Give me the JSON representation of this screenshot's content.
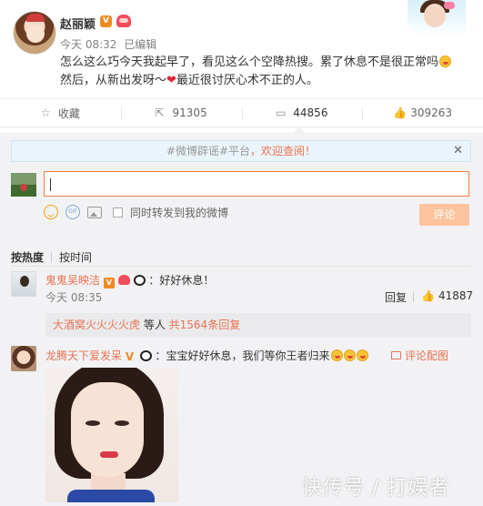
{
  "post": {
    "author": "赵丽颖",
    "verified_badge": "V",
    "time": "今天 08:32",
    "edited": "已编辑",
    "line1": "怎么这么巧今天我起早了，看见这么个空降热搜。累了休息不是很正常吗",
    "line2_a": "然后，从新出发呀～",
    "line2_b": "最近很讨厌心术不正的人。",
    "heart": "❤"
  },
  "actions": {
    "favorite": "收藏",
    "repost_count": "91305",
    "comment_count": "44856",
    "like_count": "309263"
  },
  "notice": {
    "tag": "#微博辟谣#平台",
    "text": "，欢迎查阅！",
    "close": "✕"
  },
  "composer": {
    "also_repost": "同时转发到我的微博",
    "submit": "评论"
  },
  "sort": {
    "hot": "按热度",
    "time": "按时间"
  },
  "comments": [
    {
      "name": "鬼鬼吴映洁",
      "text": "：好好休息！",
      "time": "今天 08:35",
      "reply": "回复",
      "likes": "41887"
    },
    {
      "name": "龙腾天下爱发呆",
      "text": "：宝宝好好休息，我们等你王者归来",
      "pic_link": "评论配图"
    }
  ],
  "sub_replies": {
    "names": "大酒窝火火火火虎",
    "etc": " 等人 ",
    "count": "共1564条回复"
  },
  "watermark": "快传号 / 打娱者",
  "colors": {
    "accent": "#eb7350",
    "input_border": "#fa7d3c",
    "submit_disabled": "#fdc39d"
  }
}
